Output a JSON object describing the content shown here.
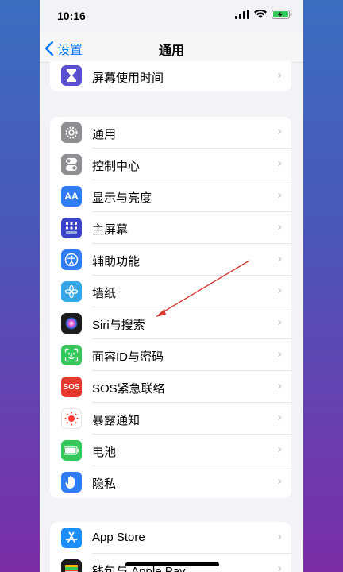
{
  "status": {
    "time": "10:16"
  },
  "nav": {
    "back_label": "设置",
    "title": "通用"
  },
  "groups": [
    {
      "items": [
        {
          "label": "屏幕使用时间",
          "icon": "hourglass-icon",
          "color": "#5a4fcf"
        }
      ]
    },
    {
      "items": [
        {
          "label": "通用",
          "icon": "gear-icon",
          "color": "#8e8e93"
        },
        {
          "label": "控制中心",
          "icon": "toggle-icon",
          "color": "#8e8e93"
        },
        {
          "label": "显示与亮度",
          "icon": "text-size-icon",
          "color": "#2f7cf6",
          "glyph": "AA"
        },
        {
          "label": "主屏幕",
          "icon": "home-grid-icon",
          "color": "#3b43c9"
        },
        {
          "label": "辅助功能",
          "icon": "accessibility-icon",
          "color": "#2f7cf6"
        },
        {
          "label": "墙纸",
          "icon": "flower-icon",
          "color": "#35a6e8"
        },
        {
          "label": "Siri与搜索",
          "icon": "siri-icon",
          "color": "#222"
        },
        {
          "label": "面容ID与密码",
          "icon": "faceid-icon",
          "color": "#34c759"
        },
        {
          "label": "SOS紧急联络",
          "icon": "sos-icon",
          "color": "#e5392f",
          "glyph": "SOS"
        },
        {
          "label": "暴露通知",
          "icon": "exposure-icon",
          "color": "#ffffff"
        },
        {
          "label": "电池",
          "icon": "battery-icon",
          "color": "#34c759"
        },
        {
          "label": "隐私",
          "icon": "hand-icon",
          "color": "#2f7cf6"
        }
      ]
    },
    {
      "items": [
        {
          "label": "App Store",
          "icon": "appstore-icon",
          "color": "#1c8ef9"
        },
        {
          "label": "钱包与 Apple Pay",
          "icon": "wallet-icon",
          "color": "#222"
        }
      ]
    }
  ]
}
